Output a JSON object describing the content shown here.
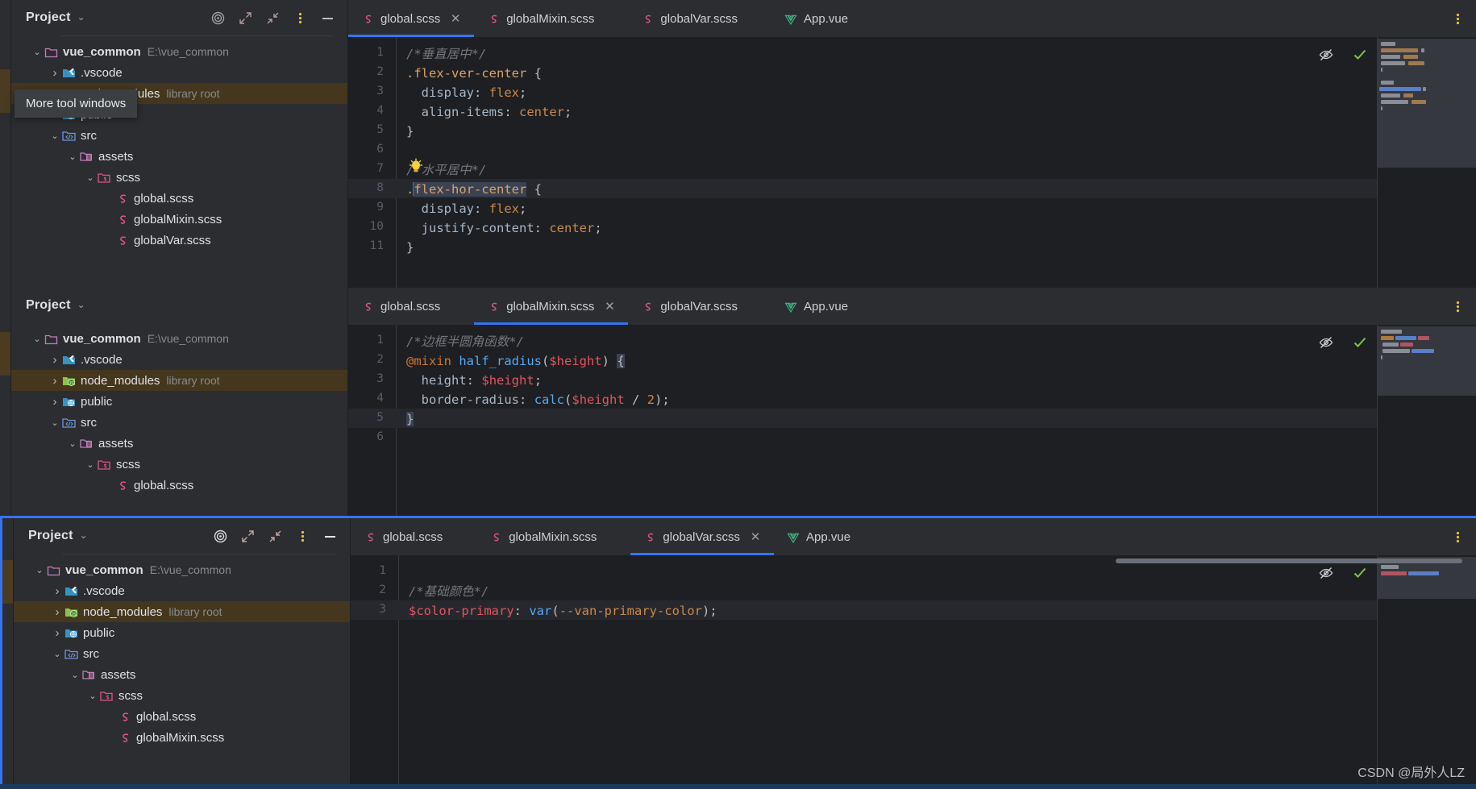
{
  "watermark": "CSDN @局外人LZ",
  "tooltip": {
    "text": "More tool windows"
  },
  "project_pane": {
    "title": "Project",
    "chevron": "⌄",
    "icons": {
      "locate": "target-icon",
      "expand": "expand-all-icon",
      "collapse": "collapse-all-icon",
      "options": "more-options-icon",
      "hide": "minimize-icon"
    }
  },
  "tree": {
    "root": {
      "label": "vue_common",
      "note": "E:\\vue_common"
    },
    "items": [
      {
        "label": ".vscode",
        "note": "",
        "icon": "folder-vscode",
        "depth": 1,
        "arrow": "collapsed"
      },
      {
        "label": "node_modules",
        "note": "library root",
        "icon": "folder-node",
        "depth": 1,
        "arrow": "collapsed",
        "highlighted": true
      },
      {
        "label": "public",
        "note": "",
        "icon": "folder-public",
        "depth": 1,
        "arrow": "collapsed"
      },
      {
        "label": "src",
        "note": "",
        "icon": "folder-src",
        "depth": 1,
        "arrow": "expanded"
      },
      {
        "label": "assets",
        "note": "",
        "icon": "folder-assets",
        "depth": 2,
        "arrow": "expanded"
      },
      {
        "label": "scss",
        "note": "",
        "icon": "folder-scss",
        "depth": 3,
        "arrow": "expanded"
      },
      {
        "label": "global.scss",
        "note": "",
        "icon": "scss-file",
        "depth": 4,
        "arrow": "none"
      },
      {
        "label": "globalMixin.scss",
        "note": "",
        "icon": "scss-file",
        "depth": 4,
        "arrow": "none"
      },
      {
        "label": "globalVar.scss",
        "note": "",
        "icon": "scss-file",
        "depth": 4,
        "arrow": "none"
      }
    ]
  },
  "tabs": [
    {
      "label": "global.scss",
      "icon": "scss-file"
    },
    {
      "label": "globalMixin.scss",
      "icon": "scss-file"
    },
    {
      "label": "globalVar.scss",
      "icon": "scss-file"
    },
    {
      "label": "App.vue",
      "icon": "vue-file"
    }
  ],
  "panels": [
    {
      "id": "panel-1",
      "active_tab_index": 0,
      "close_label": "✕",
      "code_file": "global.scss",
      "lines": [
        {
          "n": "1",
          "html": "<span class='cmt'>/*垂直居中*/</span>"
        },
        {
          "n": "2",
          "html": "<span class='sel'>.flex-ver-center</span> <span class='brace'>{</span>"
        },
        {
          "n": "3",
          "html": "  <span class='prop'>display</span><span class='punc'>:</span> <span class='val'>flex</span><span class='punc'>;</span>"
        },
        {
          "n": "4",
          "html": "  <span class='prop'>align-items</span><span class='punc'>:</span> <span class='val'>center</span><span class='punc'>;</span>"
        },
        {
          "n": "5",
          "html": "<span class='brace'>}</span>"
        },
        {
          "n": "6",
          "html": ""
        },
        {
          "n": "7",
          "html": "<span class='cmt'>/*水平居中*/</span>"
        },
        {
          "n": "8",
          "html": "<span class='sel'>.</span><span class='caret'></span><span class='hl-token sel'>flex-hor-center</span> <span class='brace'>{</span>"
        },
        {
          "n": "9",
          "html": "  <span class='prop'>display</span><span class='punc'>:</span> <span class='val'>flex</span><span class='punc'>;</span>"
        },
        {
          "n": "10",
          "html": "  <span class='prop'>justify-content</span><span class='punc'>:</span> <span class='val'>center</span><span class='punc'>;</span>"
        },
        {
          "n": "11",
          "html": "<span class='brace'>}</span>"
        }
      ],
      "plain_lines": [
        "/*垂直居中*/",
        ".flex-ver-center {",
        "  display: flex;",
        "  align-items: center;",
        "}",
        "",
        "/*水平居中*/",
        ".flex-hor-center {",
        "  display: flex;",
        "  justify-content: center;",
        "}"
      ],
      "has_bulb": true,
      "highlight_line": 8
    },
    {
      "id": "panel-2",
      "active_tab_index": 1,
      "close_label": "✕",
      "code_file": "globalMixin.scss",
      "lines": [
        {
          "n": "1",
          "html": "<span class='cmt'>/*边框半圆角函数*/</span>"
        },
        {
          "n": "2",
          "html": "<span class='kw'>@mixin</span> <span class='fn'>half_radius</span><span class='punc'>(</span><span class='var'>$height</span><span class='punc'>)</span> <span class='hl-token brace'>{</span>"
        },
        {
          "n": "3",
          "html": "  <span class='prop'>height</span><span class='punc'>:</span> <span class='var'>$height</span><span class='punc'>;</span>"
        },
        {
          "n": "4",
          "html": "  <span class='prop'>border-radius</span><span class='punc'>:</span> <span class='fn'>calc</span><span class='punc'>(</span><span class='var'>$height</span> <span class='punc'>/</span> <span class='num'>2</span><span class='punc'>);</span>"
        },
        {
          "n": "5",
          "html": "<span class='hl-token brace'>}</span>"
        },
        {
          "n": "6",
          "html": ""
        }
      ],
      "plain_lines": [
        "/*边框半圆角函数*/",
        "@mixin half_radius($height) {",
        "  height: $height;",
        "  border-radius: calc($height / 2);",
        "}",
        ""
      ],
      "has_bulb": false,
      "highlight_line": 5
    },
    {
      "id": "panel-3",
      "active_tab_index": 2,
      "close_label": "✕",
      "code_file": "globalVar.scss",
      "lines": [
        {
          "n": "1",
          "html": ""
        },
        {
          "n": "2",
          "html": "<span class='cmt'>/*基础颜色*/</span>"
        },
        {
          "n": "3",
          "html": "<span class='var'>$color-primary</span><span class='punc'>:</span> <span class='fn'>var</span><span class='punc'>(</span><span class='val'>--van-primary-color</span><span class='punc'>);</span>"
        }
      ],
      "plain_lines": [
        "",
        "/*基础颜色*/",
        "$color-primary: var(--van-primary-color);"
      ],
      "has_bulb": false,
      "highlight_line": 3
    }
  ],
  "editor_icons": {
    "inspection_off": "eye-crossed-icon",
    "inspection_ok": "checkmark-icon",
    "tabbar_options": "more-options-icon"
  },
  "colors": {
    "accent": "#3574f0",
    "tab_bg": "#2b2d30",
    "editor_bg": "#1e1f22",
    "tree_highlight": "#45371d",
    "scss_pink": "#e0518a",
    "vue_green": "#41b883",
    "check_green": "#7ec14b",
    "watermark": "#b9bcc2"
  }
}
